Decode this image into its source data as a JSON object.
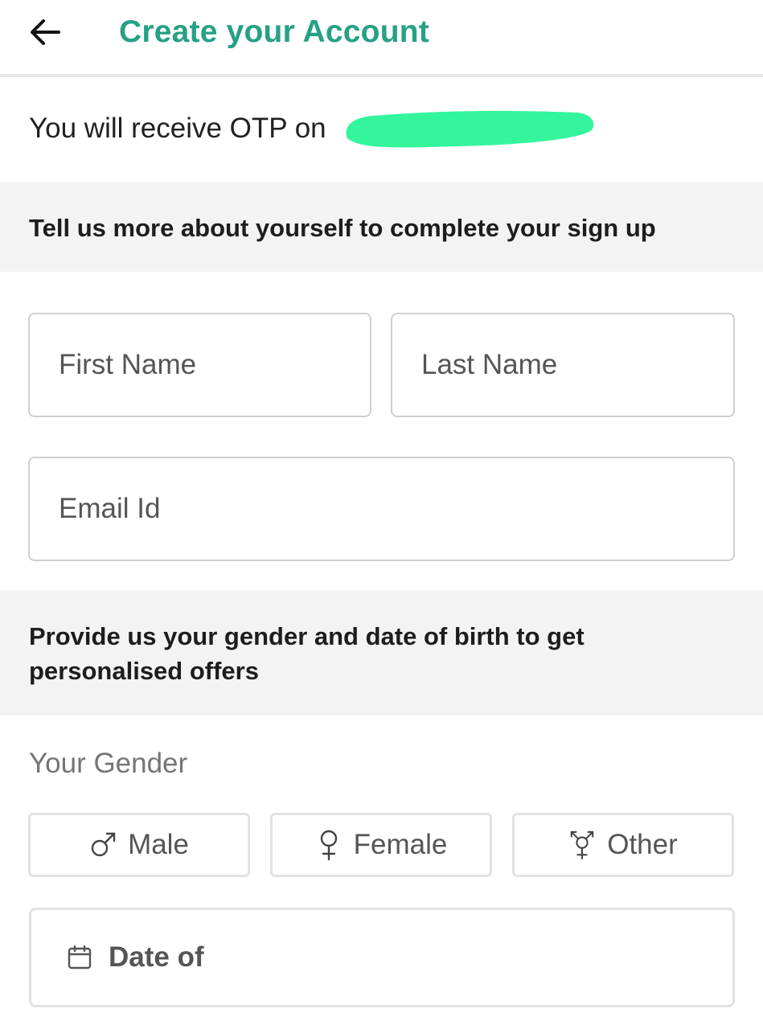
{
  "header": {
    "back_icon": "arrow-left-icon",
    "title": "Create your Account"
  },
  "otp": {
    "text": "You will receive OTP on"
  },
  "section_signup": {
    "text": "Tell us more about yourself to complete your sign up"
  },
  "form": {
    "first_name_placeholder": "First Name",
    "last_name_placeholder": "Last Name",
    "email_placeholder": "Email Id"
  },
  "section_personal": {
    "text": "Provide us your gender and date of birth to get personalised offers"
  },
  "gender": {
    "label": "Your Gender",
    "options": [
      {
        "label": "Male",
        "icon": "male-symbol-icon"
      },
      {
        "label": "Female",
        "icon": "female-symbol-icon"
      },
      {
        "label": "Other",
        "icon": "transgender-symbol-icon"
      }
    ]
  },
  "dob": {
    "label": "Date of",
    "icon": "calendar-icon"
  },
  "colors": {
    "accent": "#26a185",
    "redaction": "#33f59c",
    "band_bg": "#f3f3f3",
    "border": "#cfcfcf"
  }
}
